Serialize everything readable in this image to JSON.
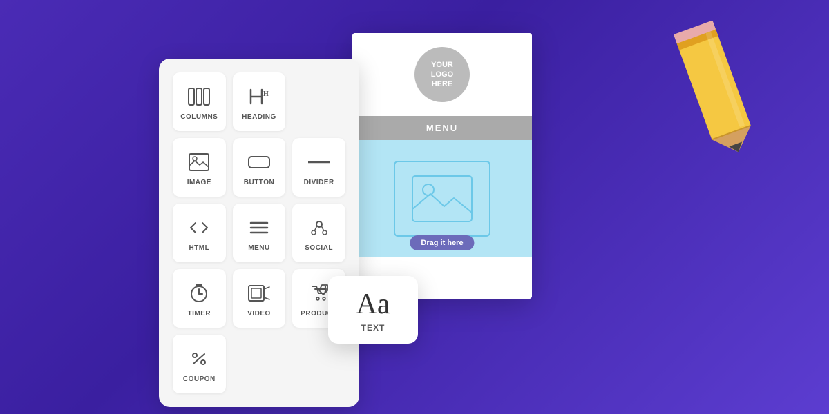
{
  "background": {
    "gradient_start": "#4a2bb5",
    "gradient_end": "#3a1fa0"
  },
  "widget_panel": {
    "items": [
      {
        "id": "columns",
        "label": "COLUMNS",
        "icon": "columns-icon"
      },
      {
        "id": "heading",
        "label": "HEADING",
        "icon": "heading-icon"
      },
      {
        "id": "empty1",
        "label": "",
        "icon": ""
      },
      {
        "id": "image",
        "label": "IMAGE",
        "icon": "image-icon"
      },
      {
        "id": "button",
        "label": "BUTTON",
        "icon": "button-icon"
      },
      {
        "id": "divider",
        "label": "DIVIDER",
        "icon": "divider-icon"
      },
      {
        "id": "html",
        "label": "HTML",
        "icon": "html-icon"
      },
      {
        "id": "menu",
        "label": "MENU",
        "icon": "menu-icon"
      },
      {
        "id": "social",
        "label": "SOCIAL",
        "icon": "social-icon"
      },
      {
        "id": "timer",
        "label": "TIMER",
        "icon": "timer-icon"
      },
      {
        "id": "video",
        "label": "VIDEO",
        "icon": "video-icon"
      },
      {
        "id": "product",
        "label": "PRODUCT",
        "icon": "product-icon"
      },
      {
        "id": "coupon",
        "label": "COUPON",
        "icon": "coupon-icon"
      }
    ]
  },
  "email_preview": {
    "logo_text": "YOUR\nLOGO\nHERE",
    "menu_label": "MENU",
    "drag_label": "Drag it here"
  },
  "text_card": {
    "symbol": "Aa",
    "label": "TEXT"
  }
}
